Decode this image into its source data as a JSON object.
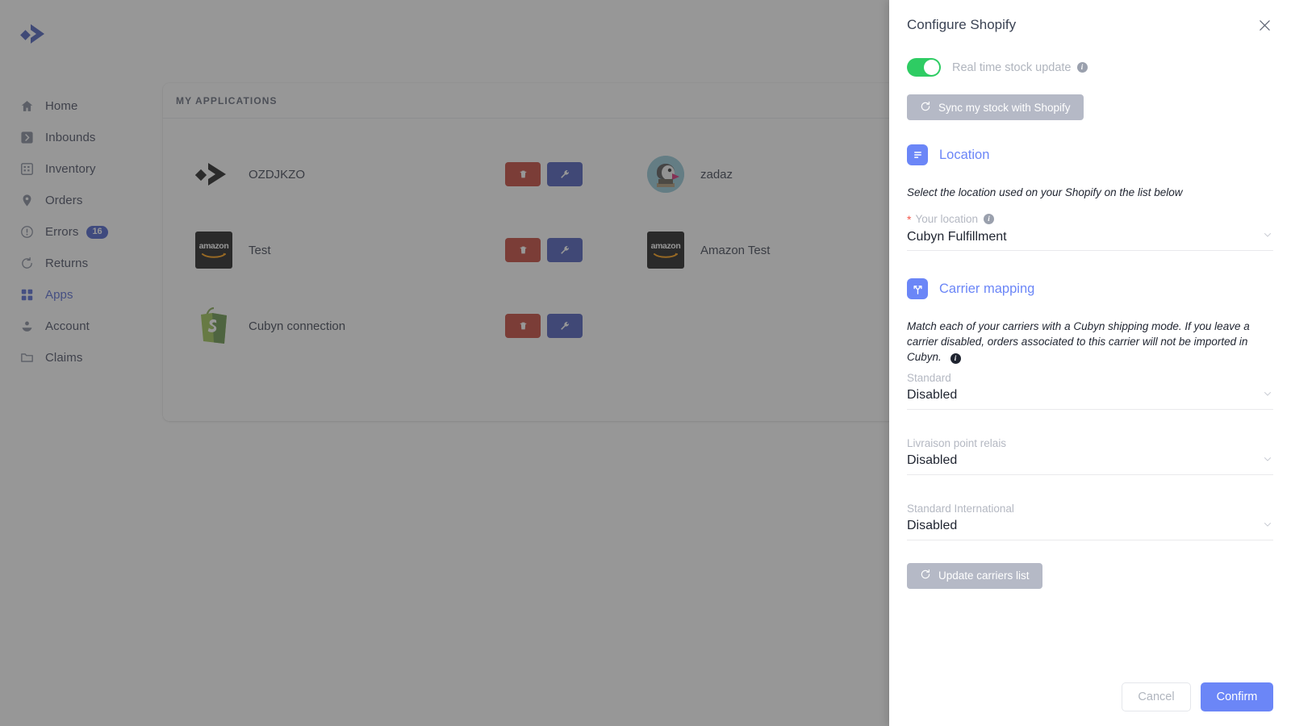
{
  "sidebar": {
    "logo": "cubyn-logo",
    "items": [
      {
        "label": "Home",
        "icon": "home-icon",
        "active": false,
        "badge": ""
      },
      {
        "label": "Inbounds",
        "icon": "inbound-icon",
        "active": false,
        "badge": ""
      },
      {
        "label": "Inventory",
        "icon": "inventory-icon",
        "active": false,
        "badge": ""
      },
      {
        "label": "Orders",
        "icon": "pin-icon",
        "active": false,
        "badge": ""
      },
      {
        "label": "Errors",
        "icon": "alert-icon",
        "active": false,
        "badge": "16"
      },
      {
        "label": "Returns",
        "icon": "return-icon",
        "active": false,
        "badge": ""
      },
      {
        "label": "Apps",
        "icon": "apps-icon",
        "active": true,
        "badge": ""
      },
      {
        "label": "Account",
        "icon": "account-icon",
        "active": false,
        "badge": ""
      },
      {
        "label": "Claims",
        "icon": "folder-icon",
        "active": false,
        "badge": ""
      }
    ]
  },
  "main": {
    "card_title": "MY APPLICATIONS",
    "applications": [
      {
        "name": "OZDJKZO",
        "logo": "cubyn-logo",
        "delete_icon": "trash-icon",
        "configure_icon": "wrench-icon",
        "has_actions": true
      },
      {
        "name": "zadaz",
        "logo": "prestashop-logo",
        "delete_icon": "",
        "configure_icon": "",
        "has_actions": false
      },
      {
        "name": "Test",
        "logo": "amazon-logo",
        "delete_icon": "trash-icon",
        "configure_icon": "wrench-icon",
        "has_actions": true
      },
      {
        "name": "Amazon Test",
        "logo": "amazon-logo",
        "delete_icon": "",
        "configure_icon": "",
        "has_actions": false
      },
      {
        "name": "Cubyn connection",
        "logo": "shopify-logo",
        "delete_icon": "trash-icon",
        "configure_icon": "wrench-icon",
        "has_actions": true
      }
    ]
  },
  "panel": {
    "title": "Configure Shopify",
    "close_icon": "close-icon",
    "realtime": {
      "label": "Real time stock update",
      "enabled": true,
      "info_icon": "info-icon"
    },
    "sync_button": {
      "label": "Sync my stock with Shopify",
      "icon": "refresh-icon"
    },
    "location_section": {
      "icon": "document-list-icon",
      "title": "Location",
      "hint": "Select the location used on your Shopify on the list below",
      "field_label": "Your location",
      "required": true,
      "info_icon": "info-icon",
      "value": "Cubyn Fulfillment",
      "chevron": "chevron-down-icon"
    },
    "carrier_section": {
      "icon": "carrier-split-icon",
      "title": "Carrier mapping",
      "hint": "Match each of your carriers with a Cubyn shipping mode. If you leave a carrier disabled, orders associated to this carrier will not be imported in Cubyn.",
      "info_icon": "info-icon",
      "carriers": [
        {
          "label": "Standard",
          "value": "Disabled",
          "chevron": "chevron-down-icon"
        },
        {
          "label": "Livraison point relais",
          "value": "Disabled",
          "chevron": "chevron-down-icon"
        },
        {
          "label": "Standard International",
          "value": "Disabled",
          "chevron": "chevron-down-icon"
        }
      ],
      "update_button": {
        "label": "Update carriers list",
        "icon": "refresh-icon"
      }
    },
    "footer": {
      "cancel_label": "Cancel",
      "confirm_label": "Confirm"
    }
  },
  "colors": {
    "accent": "#6b86f7",
    "sidebar_active": "#4a5fd0",
    "toggle_on": "#2ecc63",
    "delete": "#c0392b",
    "configure": "#3f51b5",
    "badge": "#3c56c8",
    "required": "#f4564a",
    "muted": "#b4b8c2"
  }
}
